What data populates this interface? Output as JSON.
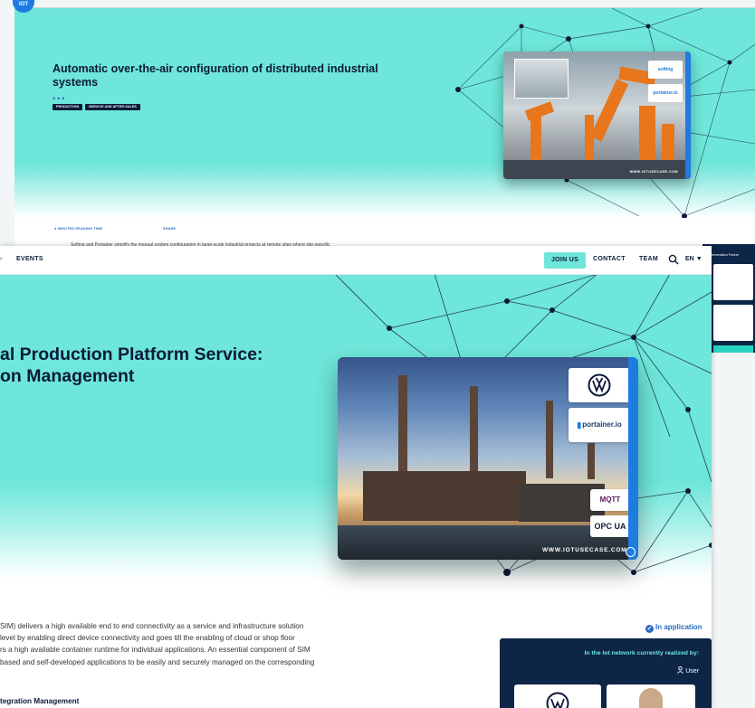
{
  "back_window": {
    "title": "Automatic over-the-air configuration of distributed industrial systems",
    "tags": [
      "PRODUCTION",
      "SERVICE AND AFTER-SALES"
    ],
    "reading_time": "4 MINUTES READING TIME",
    "share": "SHARE",
    "intro": "Softing and Portainer simplify the manual system configuration in large-scale industrial projects at remote sites where site-specific",
    "card_logos": [
      "softing",
      "portainer.io"
    ],
    "card_url": "WWW.IOTUSECASE.COM",
    "side_panel_title": "Implementation Partner"
  },
  "nav": {
    "events": "EVENTS",
    "join": "JOIN US",
    "contact": "CONTACT",
    "team": "TEAM",
    "lang": "EN"
  },
  "hero": {
    "title": "al Production Platform Service:\non Management",
    "card_logos": [
      "VW",
      "portainer.io",
      "MQTT",
      "OPC UA"
    ],
    "card_url": "WWW.IOTUSECASE.COM"
  },
  "body": {
    "lines": [
      "SIM) delivers a high available end to end connectivity as a service and infrastructure solution",
      "level by enabling direct device connectivity and goes till the enabling of cloud or shop floor",
      "rs a high available container runtime for individual applications. An essential component of SIM",
      "based and self-developed applications to be easily and securely managed on the corresponding"
    ],
    "subheading": "tegration Management"
  },
  "sidebar": {
    "status": "In application",
    "realized_title": "In the Iot network currently realized by:",
    "user_label": "User"
  },
  "colors": {
    "accent": "#6ee6d9",
    "navy": "#0c1a3a",
    "blue": "#1e7be0"
  }
}
